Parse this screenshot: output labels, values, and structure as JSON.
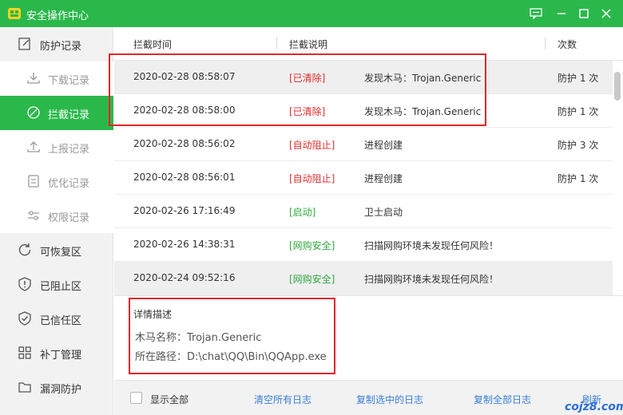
{
  "window": {
    "title": "安全操作中心",
    "controls": [
      "feedback-icon",
      "minimize-icon",
      "maximize-icon",
      "close-icon"
    ]
  },
  "sidebar": {
    "items": [
      {
        "label": "防护记录",
        "icon": "edit-doc-icon"
      },
      {
        "label": "下载记录",
        "icon": "download-icon"
      },
      {
        "label": "拦截记录",
        "icon": "block-icon"
      },
      {
        "label": "上报记录",
        "icon": "upload-icon"
      },
      {
        "label": "优化记录",
        "icon": "list-doc-icon"
      },
      {
        "label": "权限记录",
        "icon": "sliders-icon"
      },
      {
        "label": "可恢复区",
        "icon": "restore-icon"
      },
      {
        "label": "已阻止区",
        "icon": "shield-alert-icon"
      },
      {
        "label": "已信任区",
        "icon": "shield-check-icon"
      },
      {
        "label": "补丁管理",
        "icon": "grid-icon"
      },
      {
        "label": "漏洞防护",
        "icon": "folder-icon"
      }
    ]
  },
  "table": {
    "headers": {
      "time": "拦截时间",
      "desc": "拦截说明",
      "count": "次数"
    },
    "rows": [
      {
        "time": "2020-02-28 08:58:07",
        "tag": "[已清除]",
        "desc": "发现木马：Trojan.Generic",
        "count": "防护 1 次"
      },
      {
        "time": "2020-02-28 08:58:00",
        "tag": "[已清除]",
        "desc": "发现木马：Trojan.Generic",
        "count": "防护 1 次"
      },
      {
        "time": "2020-02-28 08:56:02",
        "tag": "[自动阻止]",
        "desc": "进程创建",
        "count": "防护 3 次"
      },
      {
        "time": "2020-02-28 08:56:01",
        "tag": "[自动阻止]",
        "desc": "进程创建",
        "count": "防护 1 次"
      },
      {
        "time": "2020-02-26 17:16:49",
        "tag": "[启动]",
        "desc": "卫士启动",
        "count": ""
      },
      {
        "time": "2020-02-26 14:38:31",
        "tag": "[网购安全]",
        "desc": "扫描网购环境未发现任何风险！",
        "count": ""
      },
      {
        "time": "2020-02-24 09:52:16",
        "tag": "[网购安全]",
        "desc": "扫描网购环境未发现任何风险！",
        "count": ""
      }
    ]
  },
  "detail": {
    "title": "详情描述",
    "line1": "木马名称：Trojan.Generic",
    "line2": "所在路径：D:\\chat\\QQ\\Bin\\QQApp.exe"
  },
  "footer": {
    "show_all": "显示全部",
    "clear_all": "清空所有日志",
    "copy_selected": "复制选中的日志",
    "copy_all": "复制全部日志",
    "refresh": "刷新"
  },
  "watermark": "cojz8.com",
  "colors": {
    "accent": "#2bb84b",
    "danger": "#e02b2b",
    "safe": "#2fa83f",
    "link": "#3a7fd6"
  }
}
